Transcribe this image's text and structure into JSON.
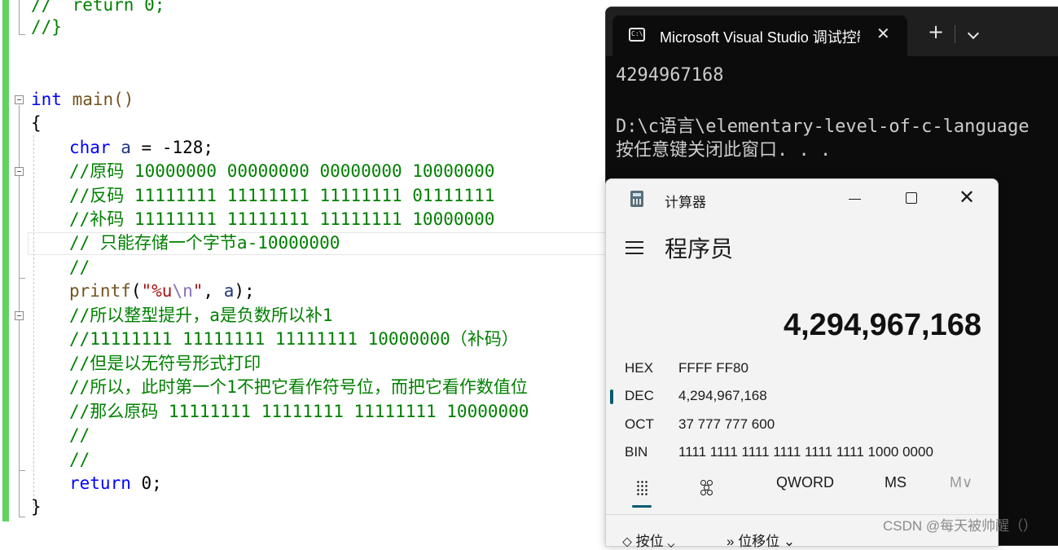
{
  "editor": {
    "lines": {
      "l1": [
        "//  return 0;"
      ],
      "l2": [
        "//}"
      ],
      "l3": [
        "int",
        " main()"
      ],
      "l4": [
        "{"
      ],
      "l5": [
        "char",
        " ",
        "a",
        " = -128;"
      ],
      "l6": [
        "//原码 10000000 00000000 00000000 10000000"
      ],
      "l7": [
        "//反码 11111111 11111111 11111111 01111111"
      ],
      "l8": [
        "//补码 11111111 11111111 11111111 10000000"
      ],
      "l9": [
        "// 只能存储一个字节a-10000000"
      ],
      "l10": [
        "//"
      ],
      "l11": [
        "printf",
        "(",
        "\"%u",
        "\\n",
        "\"",
        ", ",
        "a",
        ");"
      ],
      "l12": [
        "//所以整型提升，a是负数所以补1"
      ],
      "l13": [
        "//11111111 11111111 11111111 10000000（补码）"
      ],
      "l14": [
        "//但是以无符号形式打印"
      ],
      "l15": [
        "//所以，此时第一个1不把它看作符号位，而把它看作数值位"
      ],
      "l16": [
        "//那么原码 11111111 11111111 11111111 10000000"
      ],
      "l17": [
        "//"
      ],
      "l18": [
        "//"
      ],
      "l19": [
        "return",
        " 0;"
      ],
      "l20": [
        "}"
      ]
    }
  },
  "terminal": {
    "tab_title": "Microsoft Visual Studio 调试控制台",
    "output": [
      "4294967168",
      "D:\\c语言\\elementary-level-of-c-language",
      "按任意键关闭此窗口. . ."
    ],
    "icon": "terminal-icon"
  },
  "calculator": {
    "title": "计算器",
    "mode": "程序员",
    "display": "4,294,967,168",
    "radix": [
      {
        "label": "HEX",
        "value": "FFFF FF80"
      },
      {
        "label": "DEC",
        "value": "4,294,967,168"
      },
      {
        "label": "OCT",
        "value": "37 777 777 600"
      },
      {
        "label": "BIN",
        "value": "1111 1111 1111 1111 1111 1111 1000 0000"
      }
    ],
    "word_size": "QWORD",
    "memory_store": "MS",
    "memory_menu": "M∨",
    "bottom": [
      "按位",
      "位移位"
    ],
    "accent": "#005a70"
  },
  "watermark": "CSDN @每天被帅醒（）",
  "colors": {
    "keyword": "#0000ff",
    "comment": "#008000",
    "string": "#a31515",
    "gutter": "#5fd35f",
    "terminal_bg": "#0c0c0c"
  }
}
